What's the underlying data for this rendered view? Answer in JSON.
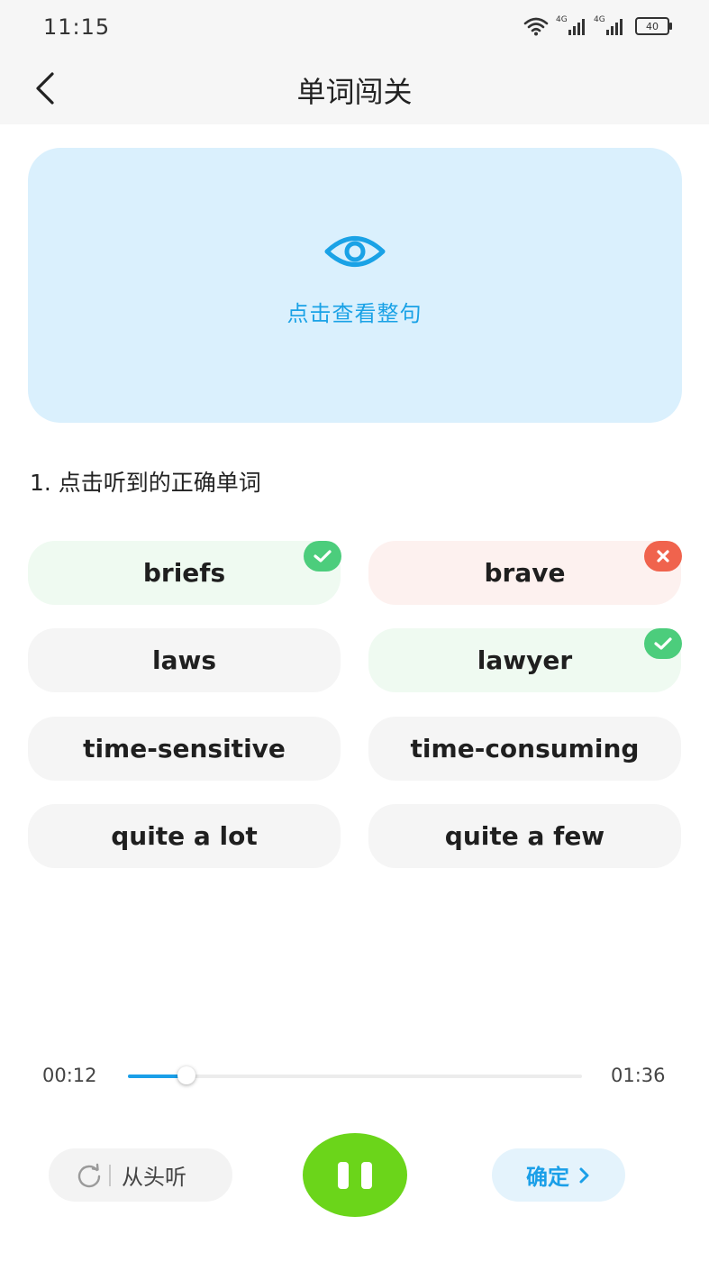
{
  "status_bar": {
    "time": "11:15",
    "signal1_label": "4G",
    "signal2_label": "4G",
    "battery_level": "40"
  },
  "header": {
    "title": "单词闯关"
  },
  "reveal": {
    "label": "点击查看整句"
  },
  "question": {
    "text": "1. 点击听到的正确单词"
  },
  "options": [
    {
      "label": "briefs",
      "state": "correct"
    },
    {
      "label": "brave",
      "state": "wrong"
    },
    {
      "label": "laws",
      "state": "none"
    },
    {
      "label": "lawyer",
      "state": "correct"
    },
    {
      "label": "time-sensitive",
      "state": "none"
    },
    {
      "label": "time-consuming",
      "state": "none"
    },
    {
      "label": "quite a lot",
      "state": "none"
    },
    {
      "label": "quite a few",
      "state": "none"
    }
  ],
  "player": {
    "current_time": "00:12",
    "total_time": "01:36",
    "progress_fraction": 0.128,
    "replay_label": "从头听",
    "confirm_label": "确定"
  },
  "colors": {
    "accent": "#1a9fe8",
    "play_green": "#6bd51a",
    "correct_green": "#4ccd7c",
    "wrong_red": "#f0634d"
  }
}
